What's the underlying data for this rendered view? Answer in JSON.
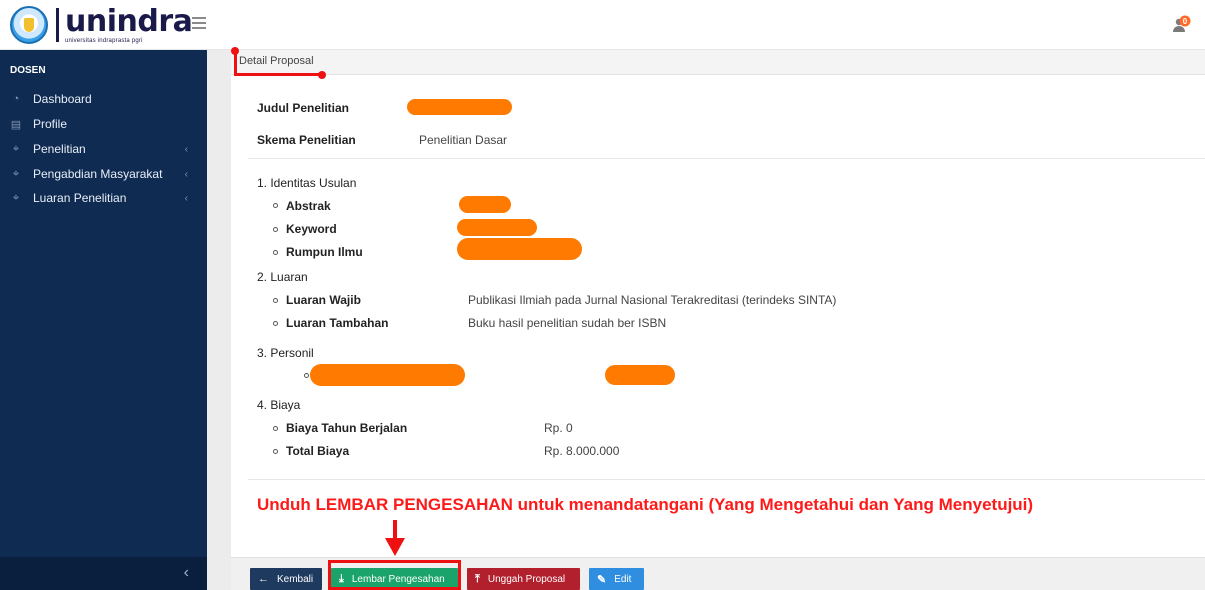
{
  "brand": {
    "name": "unindra",
    "tagline": "universitas indraprasta pgri"
  },
  "notifications": {
    "count": "0"
  },
  "sidebar": {
    "section": "DOSEN",
    "items": [
      {
        "label": "Dashboard",
        "icon": "dashboard-icon",
        "has_children": false
      },
      {
        "label": "Profile",
        "icon": "profile-card-icon",
        "has_children": false
      },
      {
        "label": "Penelitian",
        "icon": "tag-icon",
        "has_children": true
      },
      {
        "label": "Pengabdian Masyarakat",
        "icon": "tag-icon",
        "has_children": true
      },
      {
        "label": "Luaran Penelitian",
        "icon": "tag-icon",
        "has_children": true
      }
    ]
  },
  "page": {
    "title": "Detail Proposal"
  },
  "proposal": {
    "judul_label": "Judul Penelitian",
    "skema_label": "Skema Penelitian",
    "skema_value": "Penelitian Dasar",
    "identitas": {
      "heading": "1. Identitas Usulan",
      "abstrak_label": "Abstrak",
      "keyword_label": "Keyword",
      "rumpun_label": "Rumpun Ilmu"
    },
    "luaran": {
      "heading": "2. Luaran",
      "wajib_label": "Luaran Wajib",
      "wajib_value": "Publikasi Ilmiah pada Jurnal Nasional Terakreditasi (terindeks SINTA)",
      "tambahan_label": "Luaran Tambahan",
      "tambahan_value": "Buku hasil penelitian sudah ber ISBN"
    },
    "personil": {
      "heading": "3. Personil"
    },
    "biaya": {
      "heading": "4. Biaya",
      "tahun_label": "Biaya Tahun Berjalan",
      "tahun_value": "Rp. 0",
      "total_label": "Total Biaya",
      "total_value": "Rp. 8.000.000"
    }
  },
  "annotation": {
    "instruction": "Unduh LEMBAR PENGESAHAN untuk menandatangani (Yang Mengetahui dan Yang Menyetujui)"
  },
  "actions": {
    "kembali": "Kembali",
    "lembar": "Lembar Pengesahan",
    "unggah": "Unggah Proposal",
    "edit": "Edit"
  },
  "colors": {
    "sidebar_bg": "#0f2b52",
    "btn_kembali": "#1f3a5f",
    "btn_lembar": "#1aa36a",
    "btn_unggah": "#b21f2d",
    "btn_edit": "#2f8ee0",
    "redaction": "#ff7a00",
    "annotation": "#ff1a1a"
  }
}
